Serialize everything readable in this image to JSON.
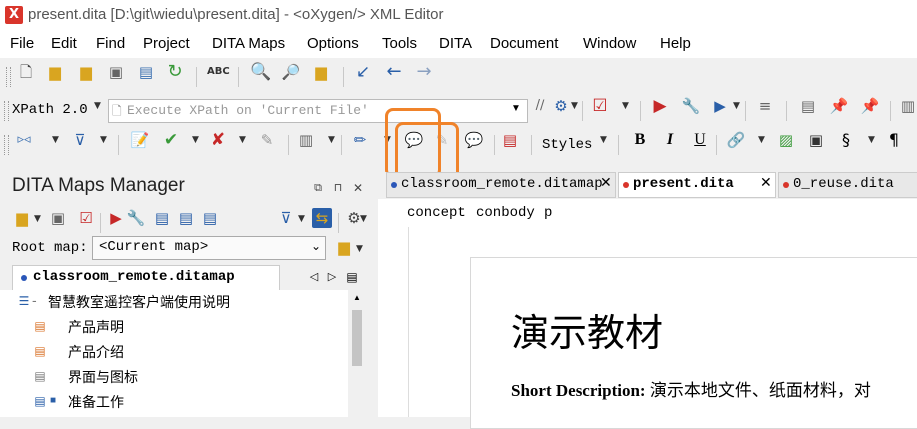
{
  "window": {
    "app_icon": "oxygen-app-icon",
    "title": "present.dita [D:\\git\\wiedu\\present.dita] - <oXygen/> XML Editor"
  },
  "menu": [
    "File",
    "Edit",
    "Find",
    "Project",
    "DITA Maps",
    "Options",
    "Tools",
    "DITA",
    "Document",
    "Window",
    "Help"
  ],
  "xpath": {
    "version_label": "XPath 2.0",
    "placeholder": "Execute XPath on  'Current File'"
  },
  "toolbar": {
    "styles_label": "Styles",
    "bold": "B",
    "italic": "I",
    "underline": "U",
    "section": "§",
    "pilcrow": "¶"
  },
  "dita_maps_manager": {
    "title": "DITA Maps Manager",
    "root_map_label": "Root map:",
    "root_map_value": "<Current map>",
    "tab_label": "classroom_remote.ditamap",
    "tree": [
      {
        "label": "智慧教室遥控客户端使用说明",
        "icon": "map-root-icon",
        "indent": 0
      },
      {
        "label": "产品声明",
        "icon": "topic-icon",
        "indent": 1
      },
      {
        "label": "产品介绍",
        "icon": "topic-icon",
        "indent": 1
      },
      {
        "label": "界面与图标",
        "icon": "topic-icon",
        "indent": 1
      },
      {
        "label": "准备工作",
        "icon": "topic-icon",
        "indent": 1
      }
    ]
  },
  "editor": {
    "tabs": [
      {
        "label": "classroom_remote.ditamap",
        "active": false
      },
      {
        "label": "present.dita",
        "active": true
      },
      {
        "label": "0_reuse.dita",
        "active": false
      }
    ],
    "breadcrumb": [
      "concept",
      "conbody",
      "p"
    ],
    "doc_title": "演示教材",
    "short_desc_label": "Short Description:",
    "short_desc_text": "演示本地文件、纸面材料，对"
  },
  "colors": {
    "highlight": "#f0832a",
    "accent_dot": "#2a56b8",
    "modified_dot": "#d9352b"
  }
}
